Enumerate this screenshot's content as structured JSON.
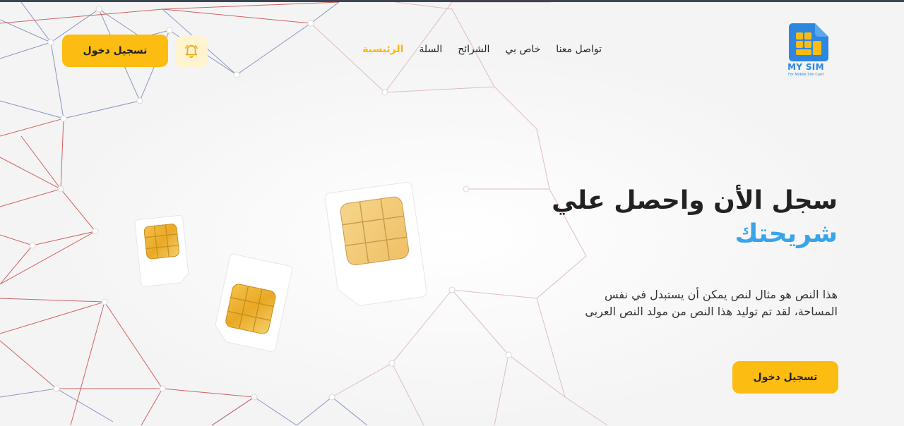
{
  "logo": {
    "title": "MY SIM",
    "tagline": "For Mobile Sim Card"
  },
  "nav": {
    "items": [
      {
        "label": "الرئيسية",
        "active": true
      },
      {
        "label": "السلة",
        "active": false
      },
      {
        "label": "الشرائح",
        "active": false
      },
      {
        "label": "خاص بي",
        "active": false
      },
      {
        "label": "تواصل معنا",
        "active": false
      }
    ]
  },
  "header": {
    "bell_icon": "bell-icon",
    "login_label": "تسجيل دخول"
  },
  "hero": {
    "title_line1": "سجل الأن واحصل علي",
    "title_line2": "شريحتك",
    "description": "هذا النص هو مثال لنص يمكن أن يستبدل في نفس المساحة، لقد تم توليد هذا النص من مولد النص العربى",
    "cta_label": "تسجيل دخول"
  },
  "colors": {
    "accent": "#fcbc11",
    "brand_blue": "#3aa4ea",
    "active_nav": "#f5b70c"
  }
}
